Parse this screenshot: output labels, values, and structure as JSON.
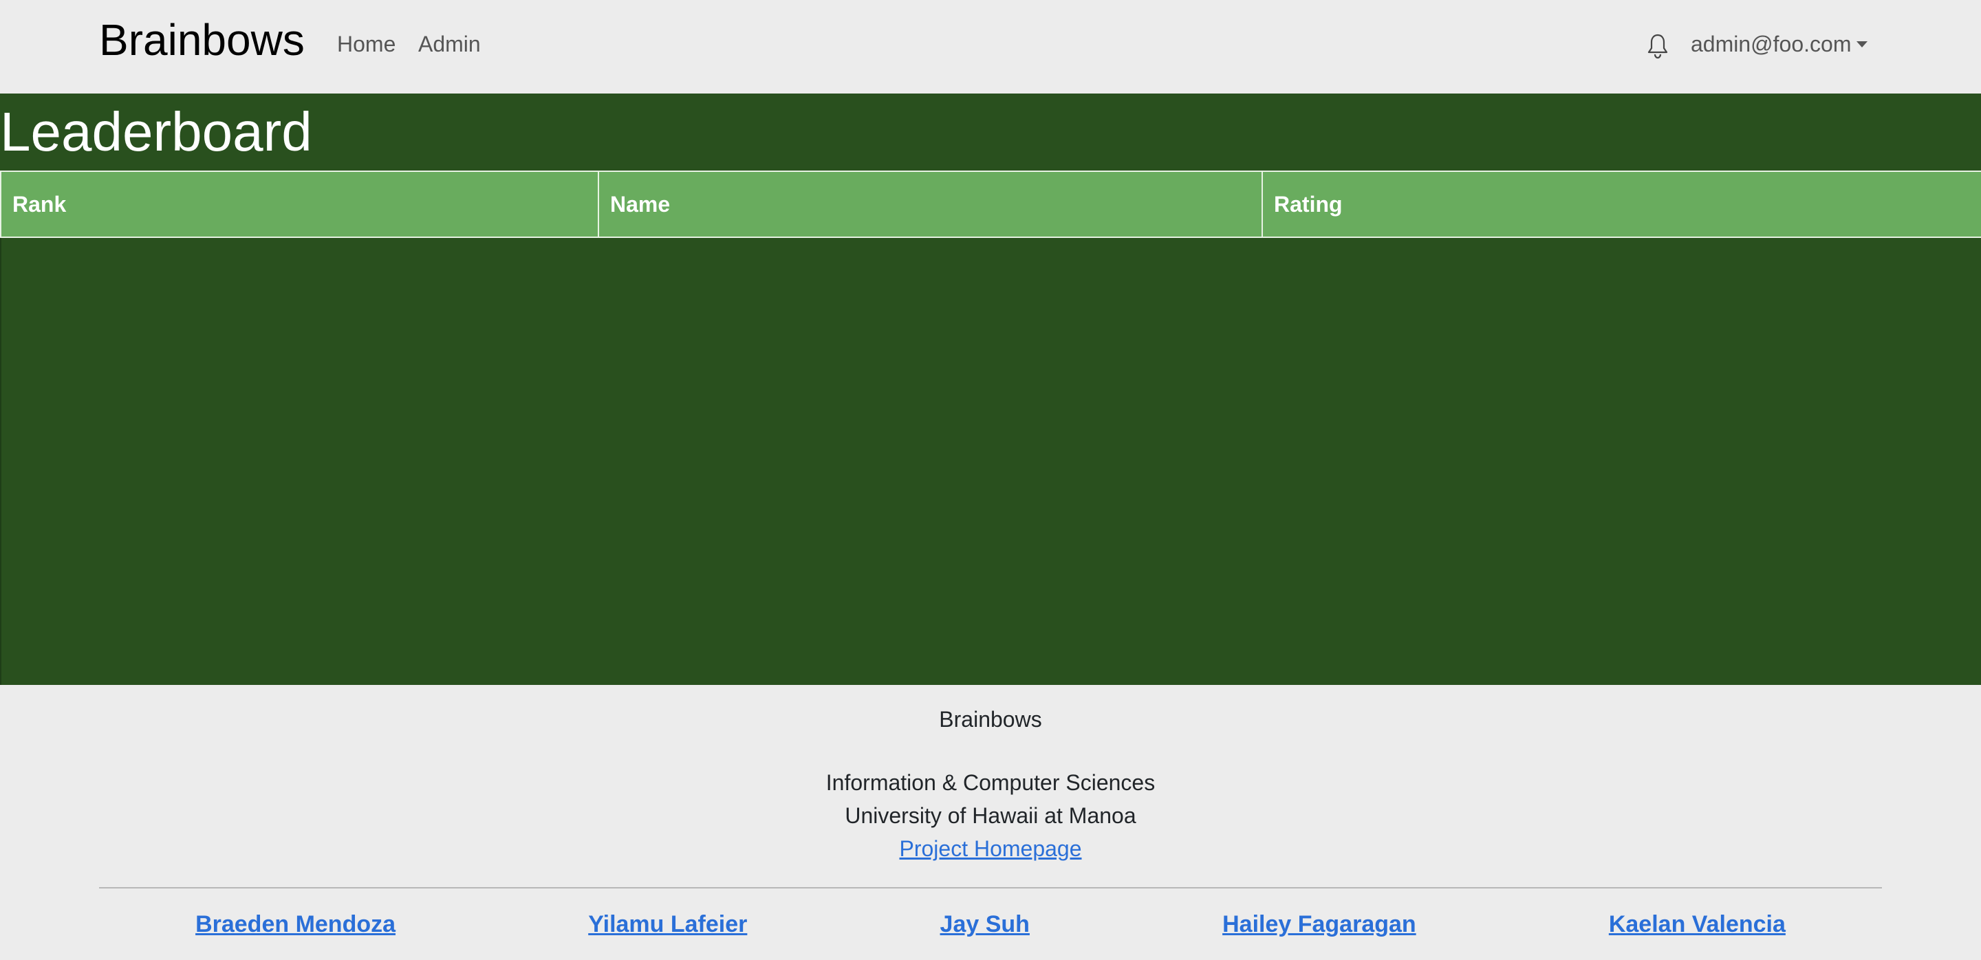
{
  "navbar": {
    "brand": "Brainbows",
    "links": [
      {
        "label": "Home"
      },
      {
        "label": "Admin"
      }
    ],
    "notification_icon": "bell-icon",
    "user_email": "admin@foo.com"
  },
  "main": {
    "title": "Leaderboard",
    "table": {
      "columns": [
        "Rank",
        "Name",
        "Rating"
      ],
      "rows": []
    }
  },
  "footer": {
    "brand": "Brainbows",
    "department": "Information & Computer Sciences",
    "university": "University of Hawaii at Manoa",
    "homepage_link": "Project Homepage",
    "team": [
      "Braeden Mendoza",
      "Yilamu Lafeier",
      "Jay Suh",
      "Hailey Fagaragan",
      "Kaelan Valencia"
    ]
  },
  "colors": {
    "navbar_bg": "#ececec",
    "main_bg": "#29501e",
    "table_header_bg": "#69ac5e",
    "link": "#2a6fd8"
  }
}
